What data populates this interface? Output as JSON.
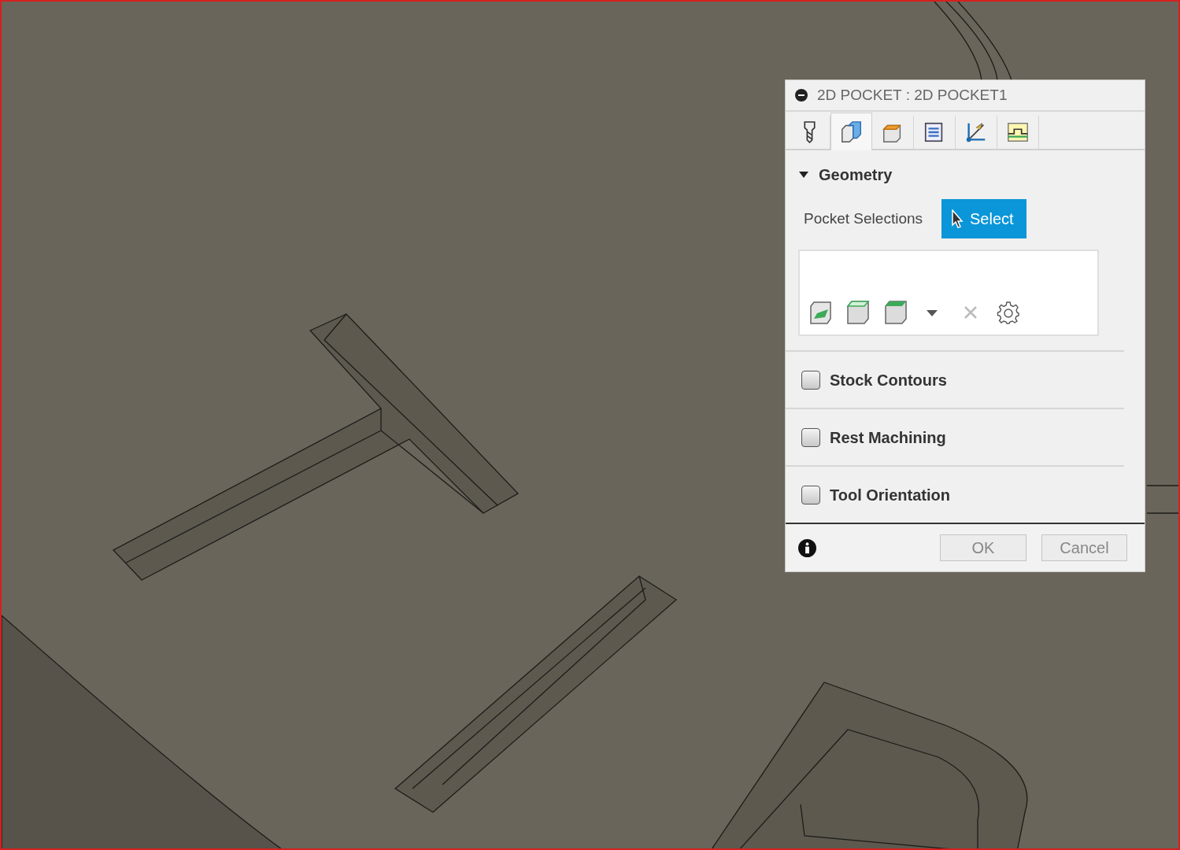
{
  "dialog": {
    "title": "2D POCKET : 2D POCKET1",
    "tabs": [
      {
        "selected": false
      },
      {
        "selected": true
      },
      {
        "selected": false
      },
      {
        "selected": false
      },
      {
        "selected": false
      },
      {
        "selected": false
      }
    ],
    "geometry": {
      "title": "Geometry",
      "expanded": true,
      "field_label": "Pocket Selections",
      "select_button": "Select"
    },
    "options": [
      {
        "label": "Stock Contours",
        "checked": false
      },
      {
        "label": "Rest Machining",
        "checked": false
      },
      {
        "label": "Tool Orientation",
        "checked": false
      }
    ],
    "buttons": {
      "ok": "OK",
      "cancel": "Cancel"
    }
  }
}
